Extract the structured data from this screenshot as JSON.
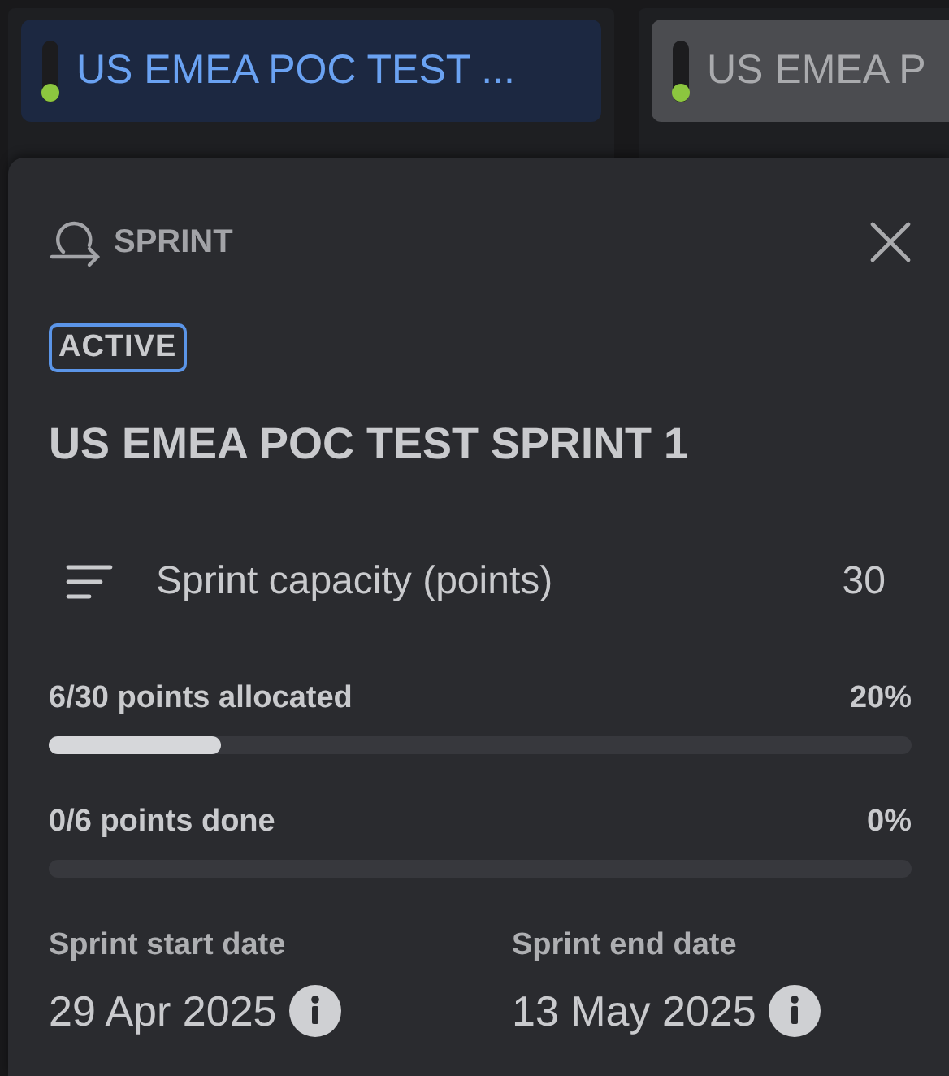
{
  "tabs": [
    {
      "label": "US EMEA POC TEST ...",
      "selected": true
    },
    {
      "label": "US EMEA P",
      "selected": false
    }
  ],
  "popover": {
    "kind_label": "SPRINT",
    "status": "ACTIVE",
    "title": "US EMEA POC TEST SPRINT 1",
    "capacity": {
      "label": "Sprint capacity (points)",
      "value": "30"
    },
    "progress": [
      {
        "label": "6/30 points allocated",
        "percent": "20%",
        "level": 0.2
      },
      {
        "label": "0/6 points done",
        "percent": "0%"
      }
    ],
    "dates": [
      {
        "label": "Sprint start date",
        "value": "29 Apr 2025"
      },
      {
        "label": "Sprint end date",
        "value": "13 May 2025"
      }
    ]
  }
}
